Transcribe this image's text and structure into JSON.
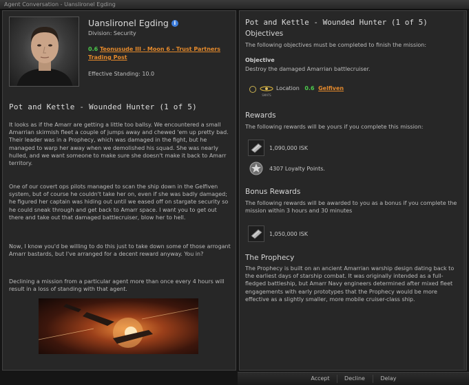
{
  "window": {
    "title": "Agent Conversation - Uanslironel Egding"
  },
  "agent": {
    "name": "Uanslironel Egding",
    "division": "Division: Security",
    "location_security": "0.6",
    "location_name": "Teonusude III - Moon 6 - Trust Partners Trading Post",
    "effective_standing": "Effective Standing: 10.0"
  },
  "mission_left": {
    "title": "Pot and Kettle - Wounded Hunter (1 of 5)",
    "paragraphs": [
      "It looks as if the Amarr are getting a little too ballsy. We encountered a small Amarrian skirmish fleet a couple of jumps away and chewed 'em up pretty bad. Their leader was in a Prophecy, which was damaged in the fight, but he managed to warp her away when we demolished his squad. She was nearly hulled, and we want someone to make sure she doesn't make it back to Amarr territory.",
      "One of our covert ops pilots managed to scan the ship down in the Gelfiven system, but of course he couldn't take her on, even if she was badly damaged; he figured her captain was hiding out until we eased off on stargate security so he could sneak through and get back to Amarr space. I want you to get out there and take out that damaged battlecruiser, blow her to hell.",
      "Now, I know you'd be willing to do this just to take down some of those arrogant Amarr bastards, but I've arranged for a decent reward anyway. You in?",
      "Declining a mission from a particular agent more than once every 4 hours will result in a loss of standing with that agent."
    ]
  },
  "mission_right": {
    "title": "Pot and Kettle - Wounded Hunter (1 of 5)",
    "objectives_heading": "Objectives",
    "objectives_desc": "The following objectives must be completed to finish the mission:",
    "objective_label": "Objective",
    "objective_text": "Destroy the damaged Amarrian battlecruiser.",
    "location_label": "Location",
    "location_security": "0.6",
    "location_system": "Gelfiven",
    "location_icon_caption": "SMATS",
    "rewards_heading": "Rewards",
    "rewards_desc": "The following rewards will be yours if you complete this mission:",
    "reward_isk": "1,090,000 ISK",
    "reward_lp": "4307 Loyalty Points.",
    "bonus_heading": "Bonus Rewards",
    "bonus_desc": "The following rewards will be awarded to you as a bonus if you complete the mission within 3 hours and 30 minutes",
    "bonus_isk": "1,050,000 ISK",
    "ship_heading": "The Prophecy",
    "ship_desc": "The Prophecy is built on an ancient Amarrian warship design dating back to the earliest days of starship combat. It was originally intended as a full-fledged battleship, but Amarr Navy engineers determined after mixed fleet engagements with early prototypes that the Prophecy would be more effective as a slightly smaller, more mobile cruiser-class ship."
  },
  "buttons": {
    "accept": "Accept",
    "decline": "Decline",
    "delay": "Delay"
  },
  "colors": {
    "security_green": "#4cc94c",
    "link_orange": "#e58a2c",
    "info_blue": "#3d7ddc"
  },
  "icons": {
    "info": "info-icon",
    "isk": "isk-icon",
    "loyalty_points": "loyalty-points-icon",
    "location": "location-icon",
    "portrait": "agent-portrait",
    "scene": "battle-scene-image"
  }
}
